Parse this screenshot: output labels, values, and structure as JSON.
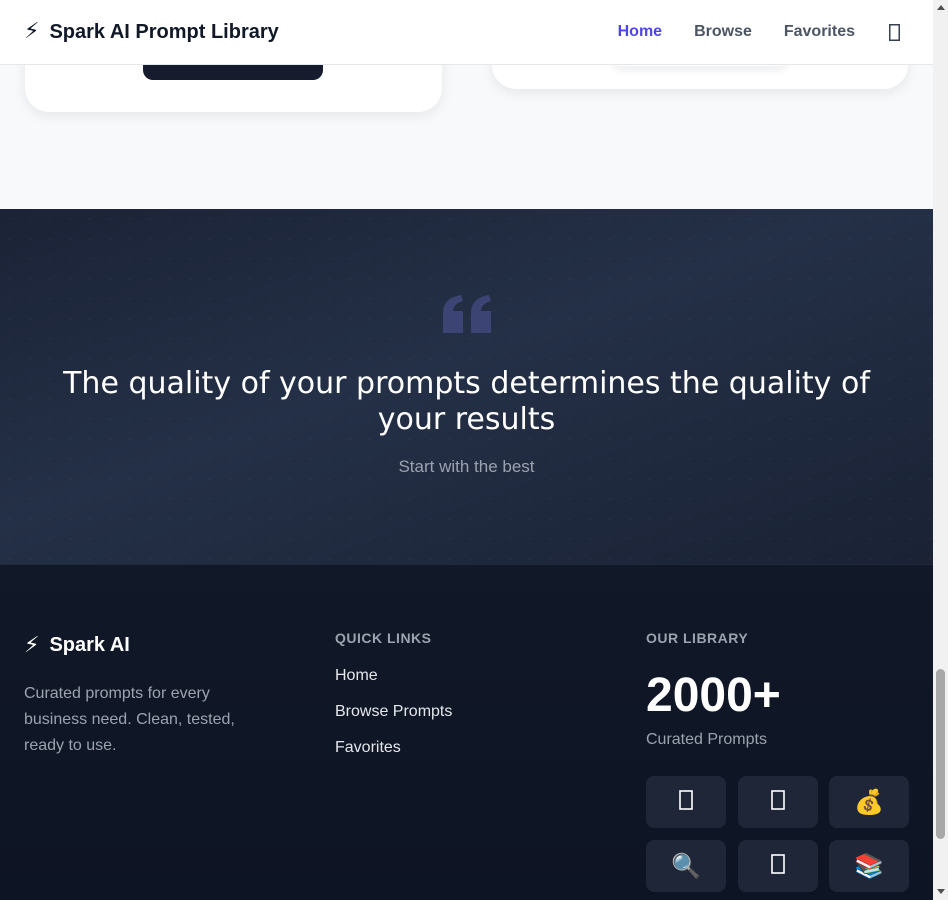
{
  "header": {
    "brand_icon": "⚡",
    "brand_name": "Spark AI Prompt Library",
    "nav": [
      {
        "label": "Home",
        "active": true
      },
      {
        "label": "Browse",
        "active": false
      },
      {
        "label": "Favorites",
        "active": false
      }
    ],
    "nav_icon": "theme-toggle-icon"
  },
  "quote": {
    "text": "The quality of your prompts determines the quality of your results",
    "subtitle": "Start with the best",
    "mark_color": "#3b4472"
  },
  "footer": {
    "brand_icon": "⚡",
    "brand_name": "Spark AI",
    "description": "Curated prompts for every business need. Clean, tested, ready to use.",
    "quick_links_heading": "QUICK LINKS",
    "quick_links": [
      "Home",
      "Browse Prompts",
      "Favorites"
    ],
    "library_heading": "OUR LIBRARY",
    "stat_value": "2000+",
    "stat_label": "Curated Prompts",
    "category_tiles": [
      {
        "icon": "missing-glyph-icon",
        "glyph": ""
      },
      {
        "icon": "missing-glyph-icon",
        "glyph": ""
      },
      {
        "icon": "money-bag-icon",
        "glyph": "💰"
      },
      {
        "icon": "magnifier-icon",
        "glyph": "🔍"
      },
      {
        "icon": "missing-glyph-icon",
        "glyph": ""
      },
      {
        "icon": "books-icon",
        "glyph": "📚"
      }
    ]
  },
  "colors": {
    "accent": "#4f46e5",
    "footer_bg": "#111827",
    "quote_bg": "#1e2638"
  }
}
